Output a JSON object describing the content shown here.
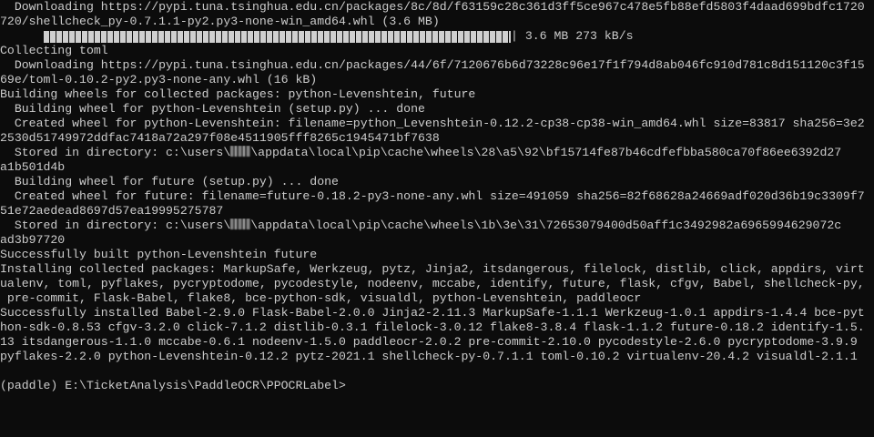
{
  "terminal": {
    "progress": {
      "fraction": 1.0,
      "text": "| 3.6 MB 273 kB/s"
    },
    "lines": [
      "  Downloading https://pypi.tuna.tsinghua.edu.cn/packages/8c/8d/f63159c28c361d3ff5ce967c478e5fb88efd5803f4daad699bdfc1720",
      "720/shellcheck_py-0.7.1.1-py2.py3-none-win_amd64.whl (3.6 MB)"
    ],
    "lines2": [
      "Collecting toml",
      "  Downloading https://pypi.tuna.tsinghua.edu.cn/packages/44/6f/7120676b6d73228c96e17f1f794d8ab046fc910d781c8d151120c3f15",
      "69e/toml-0.10.2-py2.py3-none-any.whl (16 kB)",
      "Building wheels for collected packages: python-Levenshtein, future",
      "  Building wheel for python-Levenshtein (setup.py) ... done",
      "  Created wheel for python-Levenshtein: filename=python_Levenshtein-0.12.2-cp38-cp38-win_amd64.whl size=83817 sha256=3e2",
      "2530d51749972ddfac7418a72a297f08e4511905fff8265c1945471bf7638"
    ],
    "stored1_prefix": "  Stored in directory: c:\\users\\",
    "stored1_suffix": "\\appdata\\local\\pip\\cache\\wheels\\28\\a5\\92\\bf15714fe87b46cdfefbba580ca70f86ee6392d27",
    "stored1_cont": "a1b501d4b",
    "lines3": [
      "  Building wheel for future (setup.py) ... done",
      "  Created wheel for future: filename=future-0.18.2-py3-none-any.whl size=491059 sha256=82f68628a24669adf020d36b19c3309f7",
      "51e72aedead8697d57ea19995275787"
    ],
    "stored2_prefix": "  Stored in directory: c:\\users\\",
    "stored2_suffix": "\\appdata\\local\\pip\\cache\\wheels\\1b\\3e\\31\\72653079400d50aff1c3492982a6965994629072c",
    "stored2_cont": "ad3b97720",
    "lines4": [
      "Successfully built python-Levenshtein future",
      "Installing collected packages: MarkupSafe, Werkzeug, pytz, Jinja2, itsdangerous, filelock, distlib, click, appdirs, virt",
      "ualenv, toml, pyflakes, pycryptodome, pycodestyle, nodeenv, mccabe, identify, future, flask, cfgv, Babel, shellcheck-py,",
      " pre-commit, Flask-Babel, flake8, bce-python-sdk, visualdl, python-Levenshtein, paddleocr",
      "Successfully installed Babel-2.9.0 Flask-Babel-2.0.0 Jinja2-2.11.3 MarkupSafe-1.1.1 Werkzeug-1.0.1 appdirs-1.4.4 bce-pyt",
      "hon-sdk-0.8.53 cfgv-3.2.0 click-7.1.2 distlib-0.3.1 filelock-3.0.12 flake8-3.8.4 flask-1.1.2 future-0.18.2 identify-1.5.",
      "13 itsdangerous-1.1.0 mccabe-0.6.1 nodeenv-1.5.0 paddleocr-2.0.2 pre-commit-2.10.0 pycodestyle-2.6.0 pycryptodome-3.9.9",
      "pyflakes-2.2.0 python-Levenshtein-0.12.2 pytz-2021.1 shellcheck-py-0.7.1.1 toml-0.10.2 virtualenv-20.4.2 visualdl-2.1.1",
      ""
    ],
    "prompt": "(paddle) E:\\TicketAnalysis\\PaddleOCR\\PPOCRLabel>"
  }
}
